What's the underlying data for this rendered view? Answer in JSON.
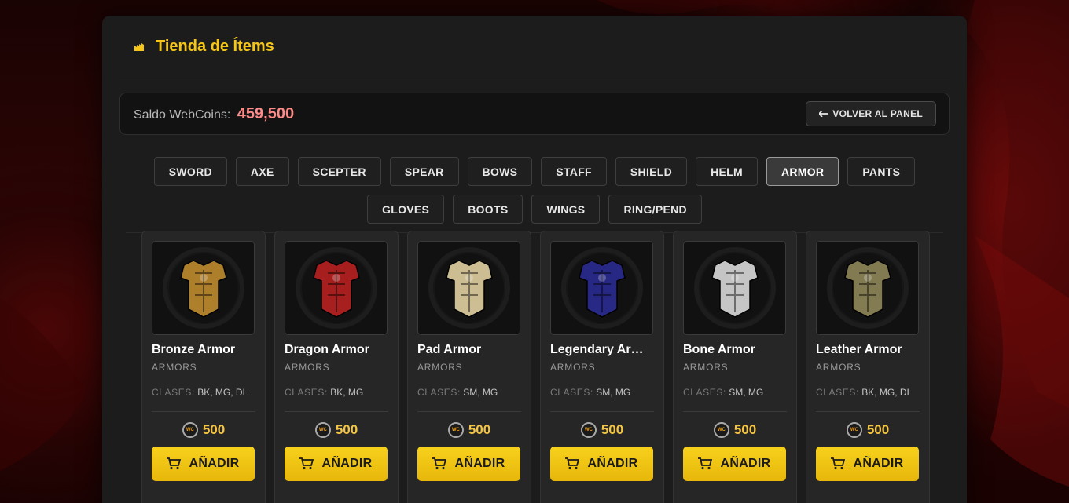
{
  "header": {
    "title": "Tienda de Ítems",
    "icon": "shop-icon"
  },
  "balance": {
    "label": "Saldo WebCoins:",
    "value": "459,500"
  },
  "back_button": {
    "label": "VOLVER AL PANEL",
    "icon": "arrow-left-icon"
  },
  "categories": [
    {
      "label": "SWORD",
      "active": false
    },
    {
      "label": "AXE",
      "active": false
    },
    {
      "label": "SCEPTER",
      "active": false
    },
    {
      "label": "SPEAR",
      "active": false
    },
    {
      "label": "BOWS",
      "active": false
    },
    {
      "label": "STAFF",
      "active": false
    },
    {
      "label": "SHIELD",
      "active": false
    },
    {
      "label": "HELM",
      "active": false
    },
    {
      "label": "ARMOR",
      "active": true
    },
    {
      "label": "PANTS",
      "active": false
    },
    {
      "label": "GLOVES",
      "active": false
    },
    {
      "label": "BOOTS",
      "active": false
    },
    {
      "label": "WINGS",
      "active": false
    },
    {
      "label": "RING/PEND",
      "active": false
    }
  ],
  "items": [
    {
      "name": "Bronze Armor",
      "category": "ARMORS",
      "classes_label": "CLASES:",
      "classes": "BK, MG, DL",
      "price": "500",
      "coin": "WC",
      "add_label": "AÑADIR",
      "color": "#b8862e"
    },
    {
      "name": "Dragon Armor",
      "category": "ARMORS",
      "classes_label": "CLASES:",
      "classes": "BK, MG",
      "price": "500",
      "coin": "WC",
      "add_label": "AÑADIR",
      "color": "#b02020"
    },
    {
      "name": "Pad Armor",
      "category": "ARMORS",
      "classes_label": "CLASES:",
      "classes": "SM, MG",
      "price": "500",
      "coin": "WC",
      "add_label": "AÑADIR",
      "color": "#d8c89a"
    },
    {
      "name": "Legendary Armor",
      "category": "ARMORS",
      "classes_label": "CLASES:",
      "classes": "SM, MG",
      "price": "500",
      "coin": "WC",
      "add_label": "AÑADIR",
      "color": "#2a2a8c"
    },
    {
      "name": "Bone Armor",
      "category": "ARMORS",
      "classes_label": "CLASES:",
      "classes": "SM, MG",
      "price": "500",
      "coin": "WC",
      "add_label": "AÑADIR",
      "color": "#d0d0d0"
    },
    {
      "name": "Leather Armor",
      "category": "ARMORS",
      "classes_label": "CLASES:",
      "classes": "BK, MG, DL",
      "price": "500",
      "coin": "WC",
      "add_label": "AÑADIR",
      "color": "#8a8256"
    }
  ]
}
